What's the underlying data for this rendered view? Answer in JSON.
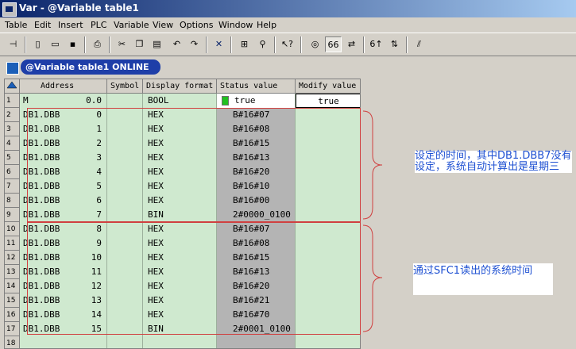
{
  "window": {
    "title": "Var - @Variable table1"
  },
  "menu": [
    "Table",
    "Edit",
    "Insert",
    "PLC",
    "Variable",
    "View",
    "Options",
    "Window",
    "Help"
  ],
  "document": {
    "title": "@Variable table1  ONLINE"
  },
  "table": {
    "headers": [
      "Address",
      "Symbol",
      "Display format",
      "Status value",
      "Modify value"
    ],
    "rows": [
      {
        "n": "1",
        "addr": "M",
        "off": "0.0",
        "fmt": "BOOL",
        "status": "true",
        "modify": "true"
      },
      {
        "n": "2",
        "addr": "DB1.DBB",
        "off": "0",
        "fmt": "HEX",
        "status": "B#16#07",
        "modify": ""
      },
      {
        "n": "3",
        "addr": "DB1.DBB",
        "off": "1",
        "fmt": "HEX",
        "status": "B#16#08",
        "modify": ""
      },
      {
        "n": "4",
        "addr": "DB1.DBB",
        "off": "2",
        "fmt": "HEX",
        "status": "B#16#15",
        "modify": ""
      },
      {
        "n": "5",
        "addr": "DB1.DBB",
        "off": "3",
        "fmt": "HEX",
        "status": "B#16#13",
        "modify": ""
      },
      {
        "n": "6",
        "addr": "DB1.DBB",
        "off": "4",
        "fmt": "HEX",
        "status": "B#16#20",
        "modify": ""
      },
      {
        "n": "7",
        "addr": "DB1.DBB",
        "off": "5",
        "fmt": "HEX",
        "status": "B#16#10",
        "modify": ""
      },
      {
        "n": "8",
        "addr": "DB1.DBB",
        "off": "6",
        "fmt": "HEX",
        "status": "B#16#00",
        "modify": ""
      },
      {
        "n": "9",
        "addr": "DB1.DBB",
        "off": "7",
        "fmt": "BIN",
        "status": "2#0000_0100",
        "modify": ""
      },
      {
        "n": "10",
        "addr": "DB1.DBB",
        "off": "8",
        "fmt": "HEX",
        "status": "B#16#07",
        "modify": ""
      },
      {
        "n": "11",
        "addr": "DB1.DBB",
        "off": "9",
        "fmt": "HEX",
        "status": "B#16#08",
        "modify": ""
      },
      {
        "n": "12",
        "addr": "DB1.DBB",
        "off": "10",
        "fmt": "HEX",
        "status": "B#16#15",
        "modify": ""
      },
      {
        "n": "13",
        "addr": "DB1.DBB",
        "off": "11",
        "fmt": "HEX",
        "status": "B#16#13",
        "modify": ""
      },
      {
        "n": "14",
        "addr": "DB1.DBB",
        "off": "12",
        "fmt": "HEX",
        "status": "B#16#20",
        "modify": ""
      },
      {
        "n": "15",
        "addr": "DB1.DBB",
        "off": "13",
        "fmt": "HEX",
        "status": "B#16#21",
        "modify": ""
      },
      {
        "n": "16",
        "addr": "DB1.DBB",
        "off": "14",
        "fmt": "HEX",
        "status": "B#16#70",
        "modify": ""
      },
      {
        "n": "17",
        "addr": "DB1.DBB",
        "off": "15",
        "fmt": "BIN",
        "status": "2#0001_0100",
        "modify": ""
      },
      {
        "n": "18",
        "addr": "",
        "off": "",
        "fmt": "",
        "status": "",
        "modify": ""
      }
    ]
  },
  "annotations": {
    "note1": {
      "text": "设定的时间，其中DB1.DBB7没有设定，系统自动计算出是星期三",
      "color": "#1e50d2"
    },
    "note2": {
      "text": "通过SFC1读出的系统时间",
      "color": "#1e50d2"
    }
  },
  "colors": {
    "mint": "#cfe9cf",
    "status_gray": "#b4b4b4",
    "annotation_red": "#d04040",
    "title_blue": "#0a246a"
  }
}
